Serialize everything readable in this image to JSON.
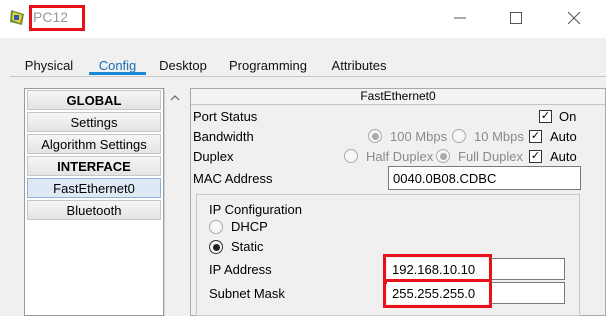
{
  "window": {
    "title": "PC12",
    "controls": [
      "minimize-icon",
      "maximize-icon",
      "close-icon"
    ]
  },
  "tabs": [
    {
      "label": "Physical"
    },
    {
      "label": "Config",
      "active": true
    },
    {
      "label": "Desktop"
    },
    {
      "label": "Programming"
    },
    {
      "label": "Attributes"
    }
  ],
  "sidebar": {
    "items": [
      {
        "label": "GLOBAL",
        "header": true
      },
      {
        "label": "Settings"
      },
      {
        "label": "Algorithm Settings"
      },
      {
        "label": "INTERFACE",
        "header": true
      },
      {
        "label": "FastEthernet0",
        "selected": true
      },
      {
        "label": "Bluetooth"
      }
    ]
  },
  "interface": {
    "title": "FastEthernet0",
    "port_status": {
      "label": "Port Status",
      "on_label": "On",
      "on": true
    },
    "bandwidth": {
      "label": "Bandwidth",
      "options": [
        "100 Mbps",
        "10 Mbps"
      ],
      "auto_label": "Auto",
      "auto": true
    },
    "duplex": {
      "label": "Duplex",
      "options": [
        "Half Duplex",
        "Full Duplex"
      ],
      "auto_label": "Auto",
      "auto": true
    },
    "mac": {
      "label": "MAC Address",
      "value": "0040.0B08.CDBC"
    },
    "ip_config": {
      "title": "IP Configuration",
      "dhcp_label": "DHCP",
      "static_label": "Static",
      "mode": "Static",
      "ip_label": "IP Address",
      "ip_value": "192.168.10.10",
      "mask_label": "Subnet Mask",
      "mask_value": "255.255.255.0"
    }
  },
  "colors": {
    "highlight": "#e8111a",
    "tab_active": "#1a6fb5"
  }
}
